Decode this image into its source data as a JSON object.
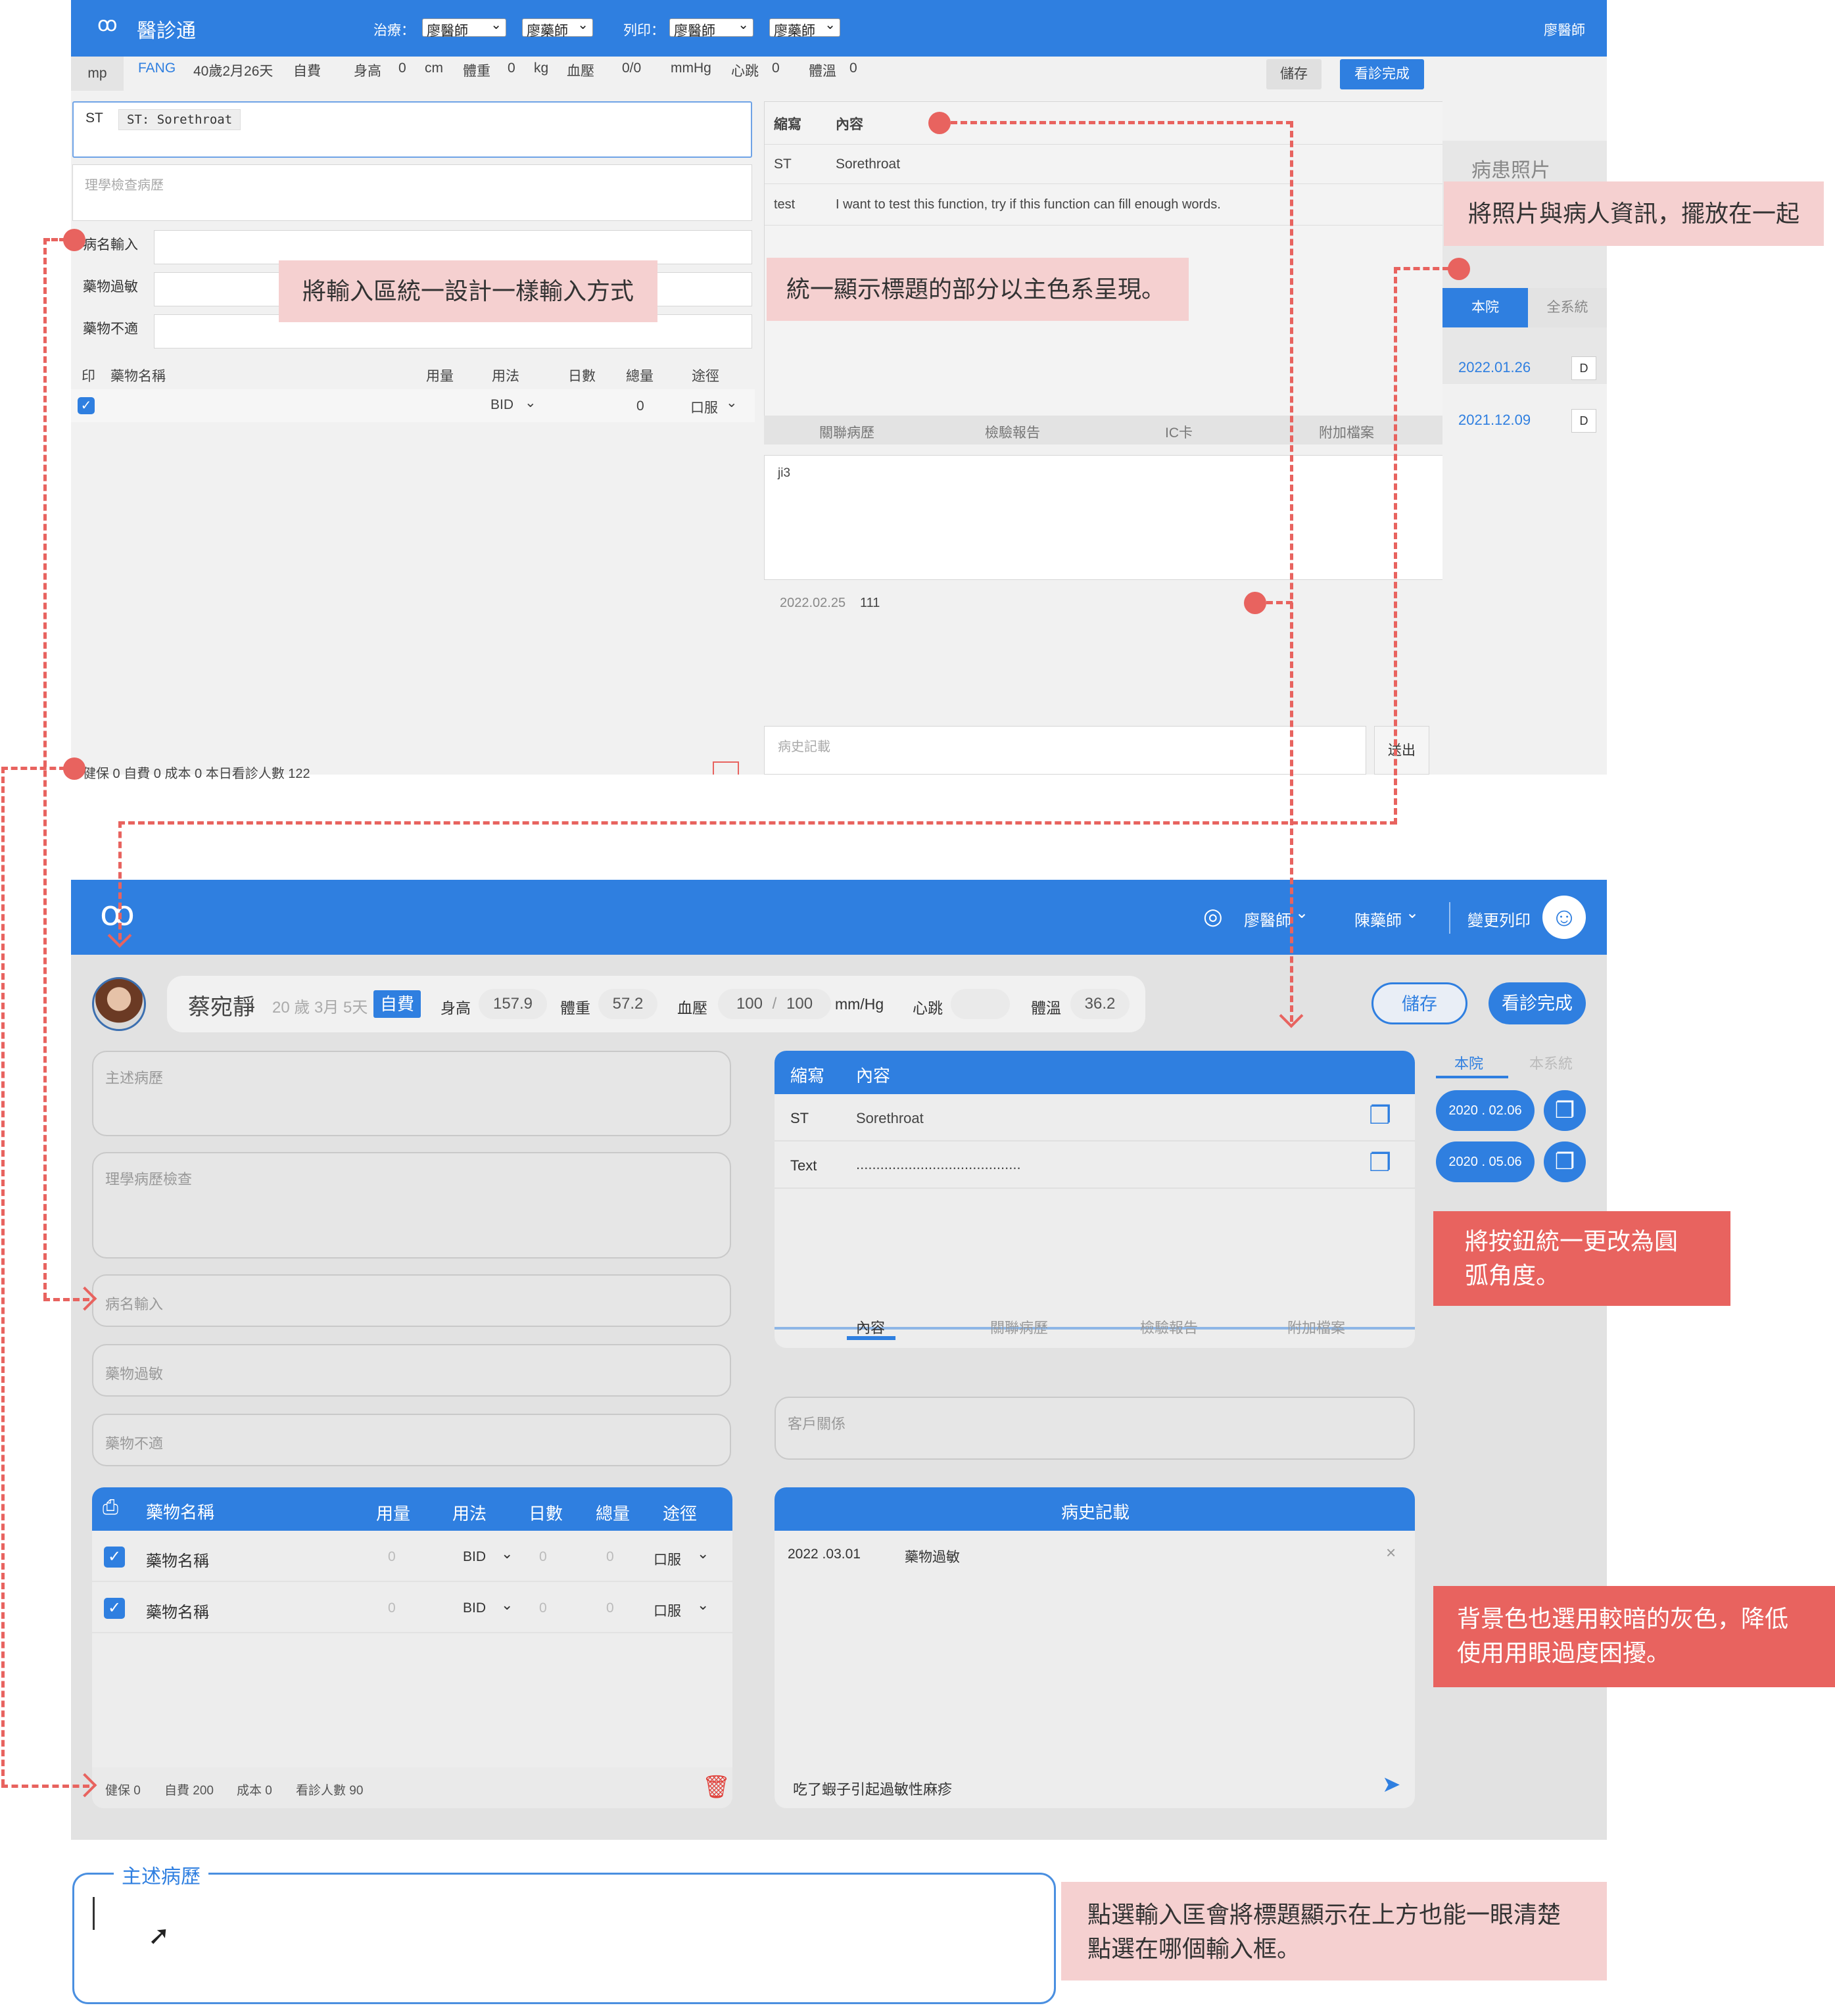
{
  "old_ui": {
    "brand": "醫診通",
    "treat_label": "治療：",
    "doctor_sel1": "廖醫師",
    "pharm_sel1": "廖藥師",
    "print_label": "列印：",
    "doctor_sel2": "廖醫師",
    "pharm_sel2": "廖藥師",
    "user": "廖醫師",
    "patient_bar": {
      "id": "mp",
      "name": "FANG",
      "age": "40歲2月26天",
      "pay": "自費",
      "height_l": "身高",
      "height_v": "0",
      "height_u": "cm",
      "weight_l": "體重",
      "weight_v": "0",
      "weight_u": "kg",
      "bp_l": "血壓",
      "bp_v": "0/0",
      "bp_u": "mmHg",
      "hr_l": "心跳",
      "hr_v": "0",
      "temp_l": "體溫",
      "temp_v": "0"
    },
    "save": "儲存",
    "finish": "看診完成",
    "complaint_value": "ST",
    "suggestion": "ST: Sorethroat",
    "exam_placeholder": "理學檢查病歷",
    "diag_label": "病名輸入",
    "allergy_label": "藥物過敏",
    "intol_label": "藥物不適",
    "drug_headers": [
      "印",
      "藥物名稱",
      "用量",
      "用法",
      "日數",
      "總量",
      "途徑"
    ],
    "drug_row": {
      "usage": "BID",
      "total": "0",
      "route": "口服"
    },
    "footer": "健保 0      自費 0      成本 0      本日看診人數 122",
    "abbr_headers": [
      "縮寫",
      "內容"
    ],
    "abbr_rows": [
      {
        "abbr": "ST",
        "content": "Sorethroat"
      },
      {
        "abbr": "test",
        "content": "I want to test this function, try if this function can fill enough words."
      }
    ],
    "tabs": [
      "關聯病歷",
      "檢驗報告",
      "IC卡",
      "附加檔案"
    ],
    "note_text": "ji3",
    "history_date": "2022.02.25",
    "history_val": "111",
    "history_placeholder": "病史記載",
    "send": "送出",
    "photo_title": "病患照片",
    "side_tabs": [
      "本院",
      "全系統"
    ],
    "visits": [
      {
        "date": "2022.01.26",
        "btn": "D"
      },
      {
        "date": "2021.12.09",
        "btn": "D"
      }
    ]
  },
  "new_ui": {
    "doctor": "廖醫師",
    "pharmacist": "陳藥師",
    "print": "變更列印",
    "patient": {
      "name": "蔡宛靜",
      "age": "20 歲 3月 5天",
      "pay": "自費",
      "height_l": "身高",
      "height_v": "157.9",
      "weight_l": "體重",
      "weight_v": "57.2",
      "bp_l": "血壓",
      "bp_sys": "100",
      "bp_sep": "/",
      "bp_dia": "100",
      "bp_u": "mm/Hg",
      "hr_l": "心跳",
      "hr_v": "",
      "temp_l": "體溫",
      "temp_v": "36.2"
    },
    "save": "儲存",
    "finish": "看診完成",
    "complaint_ph": "主述病歷",
    "exam_ph": "理學病歷檢查",
    "diag_ph": "病名輸入",
    "allergy_ph": "藥物過敏",
    "intol_ph": "藥物不適",
    "drug_headers": [
      "藥物名稱",
      "用量",
      "用法",
      "日數",
      "總量",
      "途徑"
    ],
    "drugs": [
      {
        "name": "藥物名稱",
        "dose": "0",
        "usage": "BID",
        "days": "0",
        "total": "0",
        "route": "口服"
      },
      {
        "name": "藥物名稱",
        "dose": "0",
        "usage": "BID",
        "days": "0",
        "total": "0",
        "route": "口服"
      }
    ],
    "footer": {
      "nhi": "健保 0",
      "self": "自費 200",
      "cost": "成本 0",
      "count": "看診人數 90"
    },
    "abbr_headers": [
      "縮寫",
      "內容"
    ],
    "abbr_rows": [
      {
        "abbr": "ST",
        "content": "Sorethroat"
      },
      {
        "abbr": "Text",
        "content": "........................................."
      }
    ],
    "tabs": [
      "內容",
      "關聯病歷",
      "檢驗報告",
      "附加檔案"
    ],
    "client_ph": "客戶關係",
    "history_title": "病史記載",
    "history_row": {
      "date": "2022 .03.01",
      "text": "藥物過敏"
    },
    "history_input": "吃了蝦子引起過敏性麻疹",
    "side_tabs": [
      "本院",
      "本系統"
    ],
    "visits": [
      "2020 . 02.06",
      "2020 . 05.06"
    ]
  },
  "focused_field": {
    "label": "主述病歷"
  },
  "annotations": {
    "a1": "將輸入區統一設計一樣輸入方式",
    "a2": "統一顯示標題的部分以主色系呈現。",
    "a3": "將照片與病人資訊，擺放在一起",
    "a4": "將按鈕統一更改為圓弧角度。",
    "a5": "背景色也選用較暗的灰色，降低使用用眼過度困擾。",
    "a6": "點選輸入匡會將標題顯示在上方也能一眼清楚點選在哪個輸入框。"
  }
}
